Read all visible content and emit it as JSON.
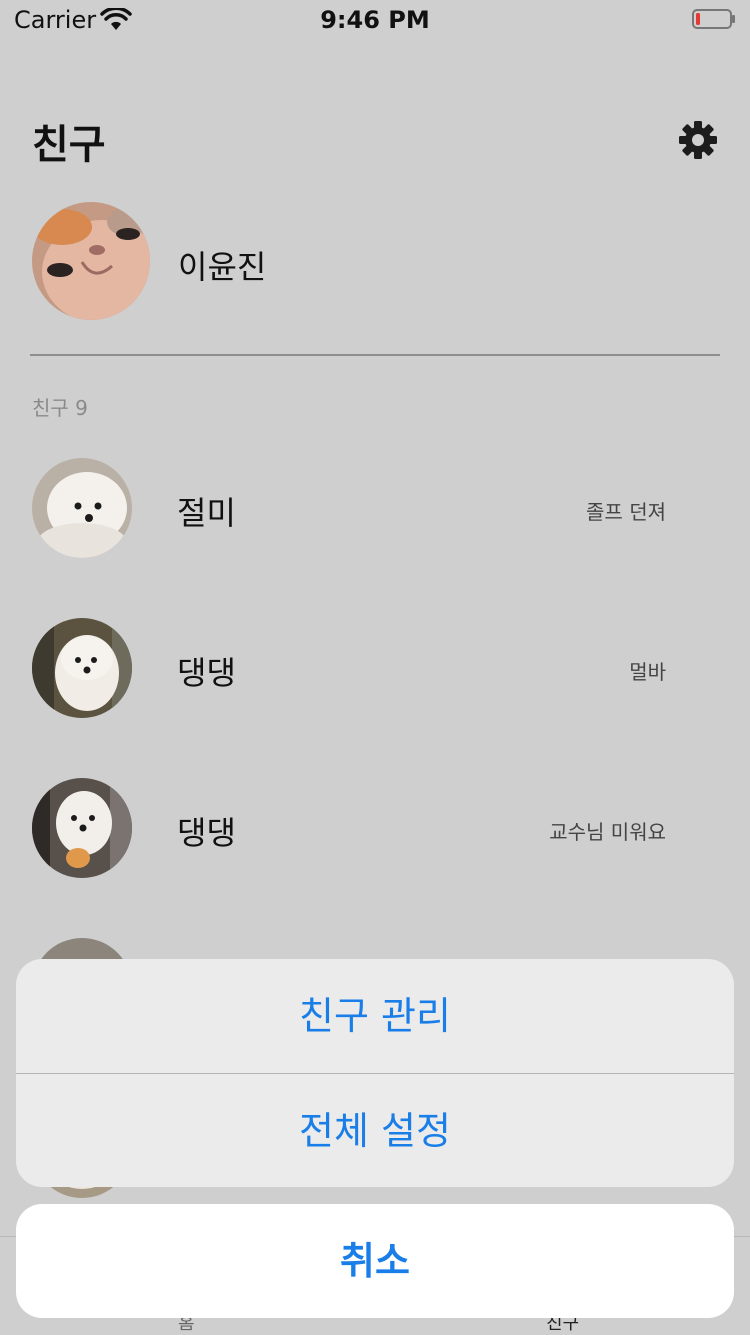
{
  "status_bar": {
    "carrier": "Carrier",
    "time": "9:46 PM",
    "battery_color": "#e53935"
  },
  "header": {
    "title": "친구"
  },
  "me": {
    "name": "이윤진"
  },
  "friends_section": {
    "count_label": "친구 9"
  },
  "friends": [
    {
      "name": "절미",
      "status": "졸프 던져"
    },
    {
      "name": "댕댕",
      "status": "멀바"
    },
    {
      "name": "댕댕",
      "status": "교수님 미워요"
    }
  ],
  "tab_bar": {
    "tabs": [
      {
        "label": "홈"
      },
      {
        "label": "친구"
      }
    ]
  },
  "action_sheet": {
    "actions": [
      {
        "label": "친구 관리"
      },
      {
        "label": "전체 설정"
      }
    ],
    "cancel_label": "취소",
    "accent_color": "#1a7ee8"
  }
}
